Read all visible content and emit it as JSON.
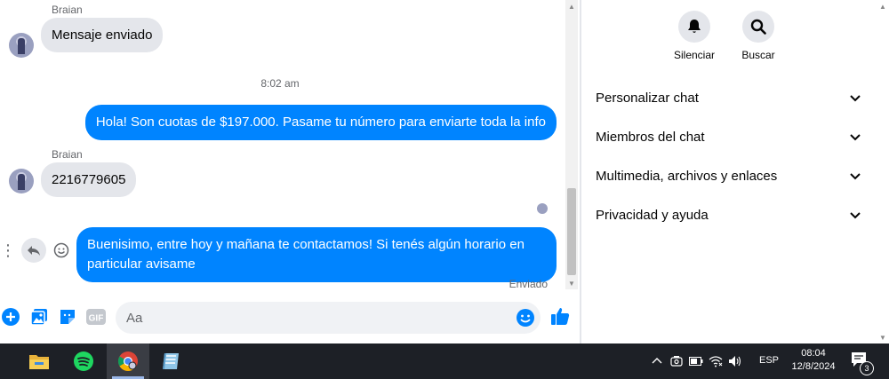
{
  "chat": {
    "messages": [
      {
        "sender": "Braian",
        "text": "Mensaje enviado"
      },
      {
        "timestamp": "8:02 am"
      },
      {
        "text": "Hola! Son cuotas de $197.000. Pasame tu número para enviarte toda la info"
      },
      {
        "sender": "Braian",
        "text": "2216779605"
      },
      {
        "text": "Buenisimo, entre hoy y mañana te contactamos! Si tenés algún horario en particular avisame",
        "status": "Enviado"
      }
    ]
  },
  "composer": {
    "placeholder": "Aa"
  },
  "panel": {
    "quick_actions": [
      {
        "label": "Silenciar",
        "icon": "bell-icon"
      },
      {
        "label": "Buscar",
        "icon": "search-icon"
      }
    ],
    "sections": [
      {
        "label": "Personalizar chat"
      },
      {
        "label": "Miembros del chat"
      },
      {
        "label": "Multimedia, archivos y enlaces"
      },
      {
        "label": "Privacidad y ayuda"
      }
    ]
  },
  "taskbar": {
    "language": "ESP",
    "time": "08:04",
    "date": "12/8/2024",
    "notification_count": "3"
  },
  "colors": {
    "accent": "#0084ff",
    "incoming": "#e4e6eb",
    "taskbar": "#1d2026"
  }
}
